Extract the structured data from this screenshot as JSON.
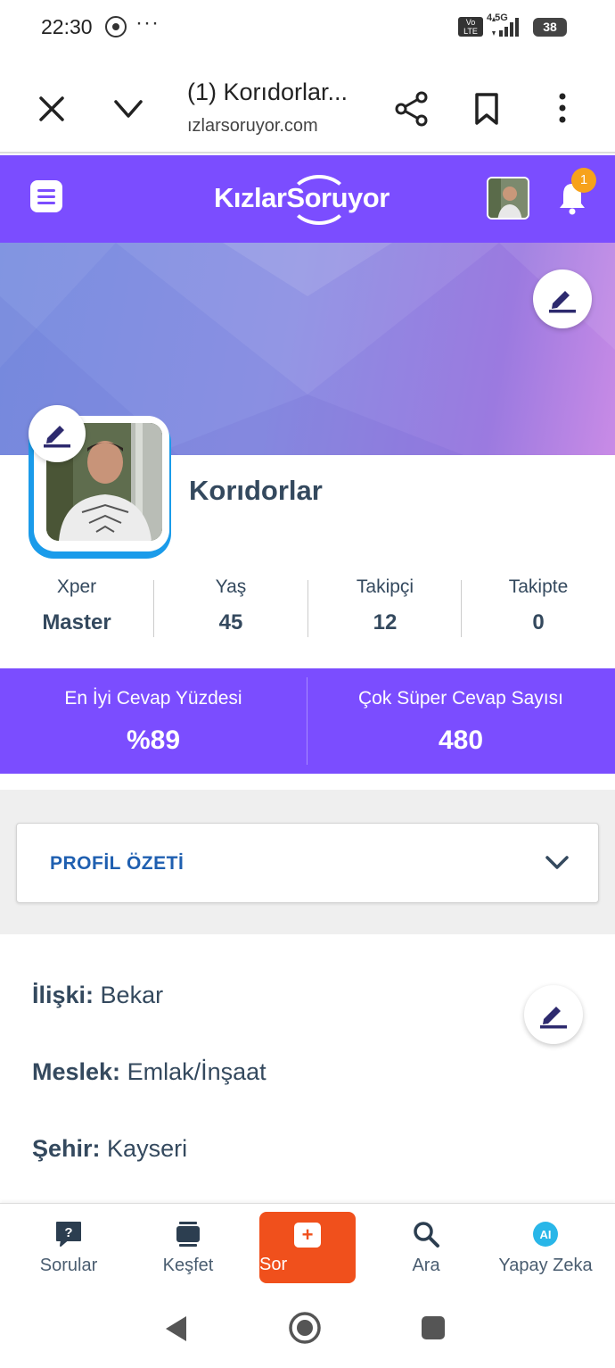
{
  "status_bar": {
    "time": "22:30",
    "overflow": "···",
    "volte": "Vo LTE",
    "network": "4.5G",
    "battery": "38",
    "icons": [
      "whatsapp-icon",
      "signal-icon",
      "battery-icon"
    ]
  },
  "browser": {
    "title": "(1) Korıdorlar...",
    "url": "ızlarsoruyor.com",
    "icons": [
      "close-icon",
      "chevron-down-icon",
      "share-icon",
      "bookmark-icon",
      "more-vertical-icon"
    ]
  },
  "site_header": {
    "logo_text": "KızlarSoruyor",
    "notification_count": "1",
    "brand_color": "#7b4dff"
  },
  "profile": {
    "name": "Korıdorlar",
    "stats": [
      {
        "label": "Xper",
        "value": "Master"
      },
      {
        "label": "Yaş",
        "value": "45"
      },
      {
        "label": "Takipçi",
        "value": "12"
      },
      {
        "label": "Takipte",
        "value": "0"
      }
    ],
    "highlights": [
      {
        "label": "En İyi Cevap Yüzdesi",
        "value": "%89"
      },
      {
        "label": "Çok Süper Cevap Sayısı",
        "value": "480"
      }
    ]
  },
  "summary": {
    "title": "PROFİL ÖZETİ"
  },
  "details": [
    {
      "key": "İlişki:",
      "value": "Bekar"
    },
    {
      "key": "Meslek:",
      "value": "Emlak/İnşaat"
    },
    {
      "key": "Şehir:",
      "value": "Kayseri"
    }
  ],
  "bottom_nav": [
    {
      "label": "Sorular",
      "icon": "question-bubble-icon"
    },
    {
      "label": "Keşfet",
      "icon": "layers-icon"
    },
    {
      "label": "Sor",
      "icon": "plus-square-icon"
    },
    {
      "label": "Ara",
      "icon": "search-icon"
    },
    {
      "label": "Yapay Zeka",
      "icon": "ai-icon"
    }
  ],
  "colors": {
    "accent_orange": "#f0501c",
    "avatar_frame": "#1a9bea",
    "link_blue": "#1f5fb0"
  }
}
